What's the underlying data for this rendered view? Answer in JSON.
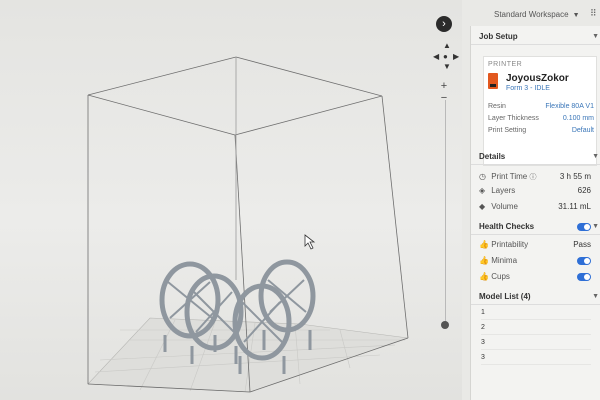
{
  "workspace": {
    "label": "Standard Workspace"
  },
  "viewport": {
    "nav_arrow": "›",
    "zoom_in": "+",
    "zoom_out": "−",
    "slider_level": 0.95
  },
  "job_setup": {
    "title": "Job Setup",
    "printer_heading": "PRINTER",
    "printer_name": "JoyousZokor",
    "printer_status": "Form 3 - IDLE",
    "resin_label": "Resin",
    "resin_value": "Flexible 80A V1",
    "layer_label": "Layer Thickness",
    "layer_value": "0.100 mm",
    "print_setting_label": "Print Setting",
    "print_setting_value": "Default"
  },
  "details": {
    "title": "Details",
    "print_time_label": "Print Time",
    "print_time_value": "3 h 55 m",
    "layers_label": "Layers",
    "layers_value": "626",
    "volume_label": "Volume",
    "volume_value": "31.11 mL"
  },
  "health_checks": {
    "title": "Health Checks",
    "items": [
      {
        "label": "Printability",
        "value": "Pass"
      },
      {
        "label": "Minima",
        "value": ""
      },
      {
        "label": "Cups",
        "value": ""
      }
    ]
  },
  "model_list": {
    "title": "Model List (4)",
    "items": [
      "1",
      "2",
      "3",
      "3"
    ]
  },
  "colors": {
    "accent": "#3a76b8",
    "toggle": "#2f6fd6",
    "pass_green": "#3c9a3c",
    "printer_orange": "#e2581f",
    "model_gray": "#8f979f"
  }
}
